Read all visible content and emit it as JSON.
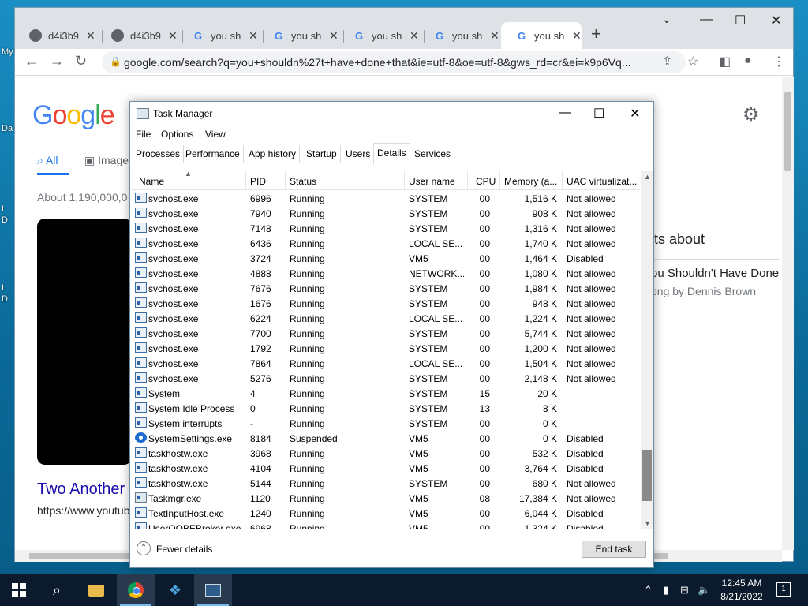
{
  "desktop": {
    "labels": [
      "My",
      "Da",
      "I\nD",
      "I\nD"
    ]
  },
  "chrome": {
    "tabs": [
      {
        "label": "d4i3b9",
        "favicon": "globe-icon"
      },
      {
        "label": "d4i3b9",
        "favicon": "globe-icon"
      },
      {
        "label": "you sh",
        "favicon": "google-icon"
      },
      {
        "label": "you sh",
        "favicon": "google-icon"
      },
      {
        "label": "you sh",
        "favicon": "google-icon"
      },
      {
        "label": "you sh",
        "favicon": "google-icon"
      },
      {
        "label": "you sh",
        "favicon": "google-icon",
        "active": true
      }
    ],
    "url": "google.com/search?q=you+shouldn%27t+have+done+that&ie=utf-8&oe=utf-8&gws_rd=cr&ei=k9p6Vq..."
  },
  "google": {
    "logo": "Google",
    "tab_all": "All",
    "tab_images": "Image",
    "stats": "About 1,190,000,0",
    "result_title": "Two Another",
    "result_url": "https://www.youtub",
    "panel_heading": "lts about",
    "panel_title": "ou Shouldn't Have Done",
    "panel_subtitle": "ong by Dennis Brown"
  },
  "taskmgr": {
    "title": "Task Manager",
    "menu": [
      "File",
      "Options",
      "View"
    ],
    "tabs": [
      "Processes",
      "Performance",
      "App history",
      "Startup",
      "Users",
      "Details",
      "Services"
    ],
    "active_tab": "Details",
    "columns": [
      "Name",
      "PID",
      "Status",
      "User name",
      "CPU",
      "Memory (a...",
      "UAC virtualizat..."
    ],
    "rows": [
      {
        "name": "svchost.exe",
        "pid": "6996",
        "status": "Running",
        "user": "SYSTEM",
        "cpu": "00",
        "mem": "1,516 K",
        "uac": "Not allowed",
        "icon": "service"
      },
      {
        "name": "svchost.exe",
        "pid": "7940",
        "status": "Running",
        "user": "SYSTEM",
        "cpu": "00",
        "mem": "908 K",
        "uac": "Not allowed",
        "icon": "service"
      },
      {
        "name": "svchost.exe",
        "pid": "7148",
        "status": "Running",
        "user": "SYSTEM",
        "cpu": "00",
        "mem": "1,316 K",
        "uac": "Not allowed",
        "icon": "service"
      },
      {
        "name": "svchost.exe",
        "pid": "6436",
        "status": "Running",
        "user": "LOCAL SE...",
        "cpu": "00",
        "mem": "1,740 K",
        "uac": "Not allowed",
        "icon": "service"
      },
      {
        "name": "svchost.exe",
        "pid": "3724",
        "status": "Running",
        "user": "VM5",
        "cpu": "00",
        "mem": "1,464 K",
        "uac": "Disabled",
        "icon": "service"
      },
      {
        "name": "svchost.exe",
        "pid": "4888",
        "status": "Running",
        "user": "NETWORK...",
        "cpu": "00",
        "mem": "1,080 K",
        "uac": "Not allowed",
        "icon": "service"
      },
      {
        "name": "svchost.exe",
        "pid": "7676",
        "status": "Running",
        "user": "SYSTEM",
        "cpu": "00",
        "mem": "1,984 K",
        "uac": "Not allowed",
        "icon": "service"
      },
      {
        "name": "svchost.exe",
        "pid": "1676",
        "status": "Running",
        "user": "SYSTEM",
        "cpu": "00",
        "mem": "948 K",
        "uac": "Not allowed",
        "icon": "service"
      },
      {
        "name": "svchost.exe",
        "pid": "6224",
        "status": "Running",
        "user": "LOCAL SE...",
        "cpu": "00",
        "mem": "1,224 K",
        "uac": "Not allowed",
        "icon": "service"
      },
      {
        "name": "svchost.exe",
        "pid": "7700",
        "status": "Running",
        "user": "SYSTEM",
        "cpu": "00",
        "mem": "5,744 K",
        "uac": "Not allowed",
        "icon": "service"
      },
      {
        "name": "svchost.exe",
        "pid": "1792",
        "status": "Running",
        "user": "SYSTEM",
        "cpu": "00",
        "mem": "1,200 K",
        "uac": "Not allowed",
        "icon": "service"
      },
      {
        "name": "svchost.exe",
        "pid": "7864",
        "status": "Running",
        "user": "LOCAL SE...",
        "cpu": "00",
        "mem": "1,504 K",
        "uac": "Not allowed",
        "icon": "service"
      },
      {
        "name": "svchost.exe",
        "pid": "5276",
        "status": "Running",
        "user": "SYSTEM",
        "cpu": "00",
        "mem": "2,148 K",
        "uac": "Not allowed",
        "icon": "service"
      },
      {
        "name": "System",
        "pid": "4",
        "status": "Running",
        "user": "SYSTEM",
        "cpu": "15",
        "mem": "20 K",
        "uac": "",
        "icon": "service"
      },
      {
        "name": "System Idle Process",
        "pid": "0",
        "status": "Running",
        "user": "SYSTEM",
        "cpu": "13",
        "mem": "8 K",
        "uac": "",
        "icon": "service"
      },
      {
        "name": "System interrupts",
        "pid": "-",
        "status": "Running",
        "user": "SYSTEM",
        "cpu": "00",
        "mem": "0 K",
        "uac": "",
        "icon": "service"
      },
      {
        "name": "SystemSettings.exe",
        "pid": "8184",
        "status": "Suspended",
        "user": "VM5",
        "cpu": "00",
        "mem": "0 K",
        "uac": "Disabled",
        "icon": "gear"
      },
      {
        "name": "taskhostw.exe",
        "pid": "3968",
        "status": "Running",
        "user": "VM5",
        "cpu": "00",
        "mem": "532 K",
        "uac": "Disabled",
        "icon": "service"
      },
      {
        "name": "taskhostw.exe",
        "pid": "4104",
        "status": "Running",
        "user": "VM5",
        "cpu": "00",
        "mem": "3,764 K",
        "uac": "Disabled",
        "icon": "service"
      },
      {
        "name": "taskhostw.exe",
        "pid": "5144",
        "status": "Running",
        "user": "SYSTEM",
        "cpu": "00",
        "mem": "680 K",
        "uac": "Not allowed",
        "icon": "service"
      },
      {
        "name": "Taskmgr.exe",
        "pid": "1120",
        "status": "Running",
        "user": "VM5",
        "cpu": "08",
        "mem": "17,384 K",
        "uac": "Not allowed",
        "icon": "taskmgr"
      },
      {
        "name": "TextInputHost.exe",
        "pid": "1240",
        "status": "Running",
        "user": "VM5",
        "cpu": "00",
        "mem": "6,044 K",
        "uac": "Disabled",
        "icon": "service"
      },
      {
        "name": "UserOOBEBroker.exe",
        "pid": "6968",
        "status": "Running",
        "user": "VM5",
        "cpu": "00",
        "mem": "1,324 K",
        "uac": "Disabled",
        "icon": "service"
      }
    ],
    "fewer_details": "Fewer details",
    "end_task": "End task"
  },
  "taskbar": {
    "time": "12:45 AM",
    "date": "8/21/2022",
    "notifications": "1"
  }
}
